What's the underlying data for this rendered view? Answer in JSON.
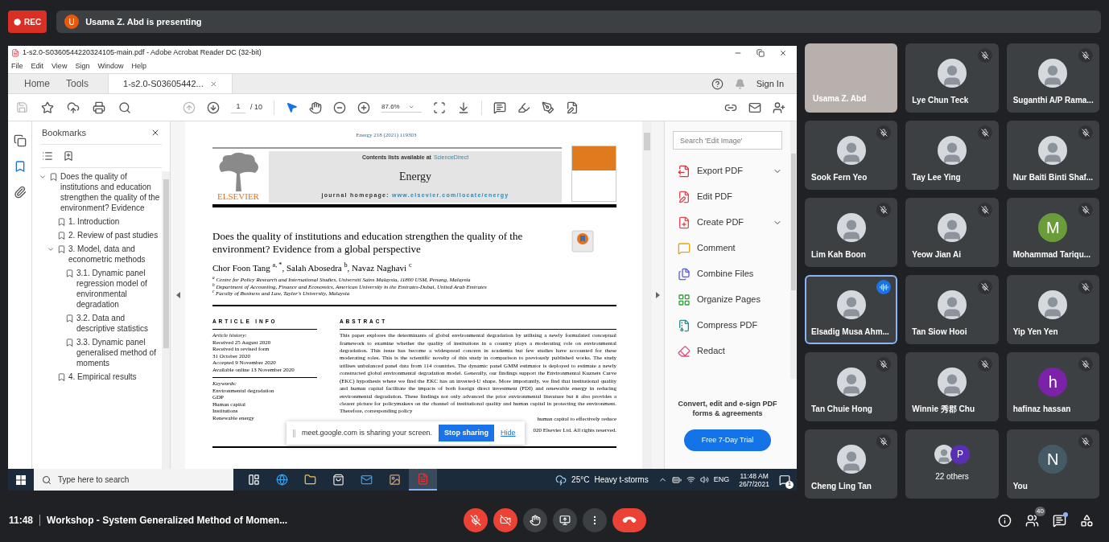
{
  "recording": {
    "label": "REC"
  },
  "presenter": {
    "initial": "U",
    "text": "Usama Z. Abd is presenting"
  },
  "acrobat": {
    "title": "1-s2.0-S0360544220324105-main.pdf - Adobe Acrobat Reader DC (32-bit)",
    "menu": [
      "File",
      "Edit",
      "View",
      "Sign",
      "Window",
      "Help"
    ],
    "tabs": [
      {
        "label": "Home",
        "selected": false
      },
      {
        "label": "Tools",
        "selected": false
      },
      {
        "label": "1-s2.0-S03605442...",
        "selected": true
      }
    ],
    "sign_in": "Sign In",
    "page": {
      "current": "1",
      "total": "/ 10"
    },
    "zoom": "87.6%",
    "rail": [
      {
        "selected": false
      },
      {
        "selected": true
      },
      {
        "selected": false
      }
    ],
    "bookmarks": {
      "title": "Bookmarks",
      "items": [
        {
          "label": "Does the quality of institutions and education strengthen the quality of the environment? Evidence",
          "expanded": true,
          "children": [
            {
              "label": "1. Introduction"
            },
            {
              "label": "2. Review of past studies"
            },
            {
              "label": "3. Model, data and econometric methods",
              "expanded": true,
              "children": [
                {
                  "label": "3.1. Dynamic panel regression model of environmental degradation"
                },
                {
                  "label": "3.2. Data and descriptive statistics"
                },
                {
                  "label": "3.3. Dynamic panel generalised method of moments"
                }
              ]
            },
            {
              "label": "4. Empirical results"
            }
          ]
        }
      ]
    },
    "document": {
      "citation": "Energy 218 (2021) 119303",
      "contents_prefix": "Contents lists available at",
      "contents_link": "ScienceDirect",
      "journal": "Energy",
      "homepage_label": "journal homepage:",
      "homepage_url": "www.elsevier.com/locate/energy",
      "publisher": "ELSEVIER",
      "title": "Does the quality of institutions and education strengthen the quality of the environment? Evidence from a global perspective",
      "authors": "Chor Foon Tang $^{a, *}$, Salah Abosedra $^{b}$, Navaz Naghavi $^{c}$",
      "affiliations": [
        "$^{a}$ Centre for Policy Research and International Studies, Universiti Sains Malaysia, 11800 USM, Penang, Malaysia",
        "$^{b}$ Department of Accounting, Finance and Economics, American University in the Emirates-Dubai, United Arab Emirates",
        "$^{c}$ Faculty of Business and Law, Taylor's University, Malaysia"
      ],
      "article_info_heading": "ARTICLE INFO",
      "history_heading": "Article history:",
      "history": [
        "Received 25 August 2020",
        "Received in revised form",
        "31 October 2020",
        "Accepted 9 November 2020",
        "Available online 13 November 2020"
      ],
      "keywords_heading": "Keywords:",
      "keywords": [
        "Environmental degradation",
        "GDP",
        "Human capital",
        "Institutions",
        "Renewable energy"
      ],
      "abstract_heading": "ABSTRACT",
      "abstract": "This paper explores the determinants of global environmental degradation by utilising a newly formulated conceptual framework to examine whether the quality of institutions in a country plays a moderating role on environmental degradation. This issue has become a widespread concern in academia but few studies have accounted for these moderating roles. This is the scientific novelty of this study in comparison to previously published works. The study utilises unbalanced panel data from 114 countries. The dynamic panel GMM estimator is deployed to estimate a newly constructed global environmental degradation model. Generally, our findings support the Environmental Kuznets Curve (EKC) hypothesis where we find the EKC has an inverted-U shape. More importantly, we find that institutional quality and human capital facilitate the impacts of both foreign direct investment (FDI) and renewable energy in reducing environmental degradation. These findings not only advanced the prior environmental literature but it also provides a clearer picture for policymakers on the channel of institutional quality and human capital in protecting the environment. Therefore, corresponding policy",
      "abstract_tail": "human capital to effectively reduce",
      "copyright_tail": "020 Elsevier Ltd. All rights reserved."
    },
    "tools": {
      "search_placeholder": "Search 'Edit Image'",
      "items": [
        {
          "label": "Export PDF",
          "color": "#d7373f",
          "expandable": true
        },
        {
          "label": "Edit PDF",
          "color": "#e34850",
          "expandable": false
        },
        {
          "label": "Create PDF",
          "color": "#e34850",
          "expandable": true
        },
        {
          "label": "Comment",
          "color": "#e8a70c",
          "expandable": false
        },
        {
          "label": "Combine Files",
          "color": "#5a5ce0",
          "expandable": false
        },
        {
          "label": "Organize Pages",
          "color": "#2d9d3a",
          "expandable": false
        },
        {
          "label": "Compress PDF",
          "color": "#2a8c8c",
          "expandable": false
        },
        {
          "label": "Redact",
          "color": "#e34881",
          "expandable": false
        }
      ],
      "promo": "Convert, edit and e-sign PDF forms & agreements",
      "trial_button": "Free 7-Day Trial"
    }
  },
  "share_notice": {
    "text": "meet.google.com is sharing your screen.",
    "stop": "Stop sharing",
    "hide": "Hide"
  },
  "taskbar": {
    "search_placeholder": "Type here to search",
    "apps": [
      {
        "selected": false
      },
      {
        "selected": false
      },
      {
        "selected": false
      },
      {
        "selected": false
      },
      {
        "selected": false
      },
      {
        "selected": false
      },
      {
        "selected": true
      }
    ],
    "temperature": "25°C",
    "weather": "Heavy t-storms",
    "language": "ENG",
    "time": "11:48 AM",
    "date": "26/7/2021",
    "notifications": "1"
  },
  "participants": [
    {
      "name": "Usama Z. Abd",
      "kind": "video",
      "muted": false,
      "speaking": false
    },
    {
      "name": "Lye Chun Teck",
      "kind": "photo",
      "muted": true,
      "speaking": false
    },
    {
      "name": "Suganthi A/P Rama...",
      "kind": "photo",
      "muted": true,
      "speaking": false
    },
    {
      "name": "Sook Fern Yeo",
      "kind": "photo",
      "muted": true,
      "speaking": false
    },
    {
      "name": "Tay Lee Ying",
      "kind": "photo",
      "muted": true,
      "speaking": false
    },
    {
      "name": "Nur Baiti Binti Shaf...",
      "kind": "photo",
      "muted": true,
      "speaking": false
    },
    {
      "name": "Lim Kah Boon",
      "kind": "photo",
      "muted": true,
      "speaking": false
    },
    {
      "name": "Yeow Jian Ai",
      "kind": "photo",
      "muted": true,
      "speaking": false
    },
    {
      "name": "Mohammad Tariqu...",
      "kind": "initial",
      "initial": "M",
      "color": "#6a9c3a",
      "muted": true,
      "speaking": false
    },
    {
      "name": "Elsadig Musa Ahm...",
      "kind": "photo",
      "muted": false,
      "speaking": true
    },
    {
      "name": "Tan Siow Hooi",
      "kind": "photo",
      "muted": true,
      "speaking": false
    },
    {
      "name": "Yip Yen Yen",
      "kind": "photo",
      "muted": true,
      "speaking": false
    },
    {
      "name": "Tan Chuie Hong",
      "kind": "photo",
      "muted": true,
      "speaking": false
    },
    {
      "name": "Winnie 秀郡 Chu",
      "kind": "photo",
      "muted": true,
      "speaking": false
    },
    {
      "name": "hafinaz hassan",
      "kind": "initial",
      "initial": "h",
      "color": "#7b22a8",
      "muted": true,
      "speaking": false
    },
    {
      "name": "Cheng Ling Tan",
      "kind": "photo",
      "muted": true,
      "speaking": false
    },
    {
      "name": "22 others",
      "kind": "group",
      "initial": "P",
      "color": "#5b2fb5",
      "muted": false,
      "speaking": false
    },
    {
      "name": "You",
      "kind": "initial",
      "initial": "N",
      "color": "#455a64",
      "muted": true,
      "speaking": false
    }
  ],
  "meeting": {
    "time": "11:48",
    "title": "Workshop - System Generalized Method of Momen...",
    "controls": [
      {
        "kind": "mic",
        "off": true
      },
      {
        "kind": "camera",
        "off": true
      },
      {
        "kind": "hand"
      },
      {
        "kind": "present"
      },
      {
        "kind": "more"
      },
      {
        "kind": "end"
      }
    ],
    "people_count": "40",
    "chat_unread": true
  }
}
